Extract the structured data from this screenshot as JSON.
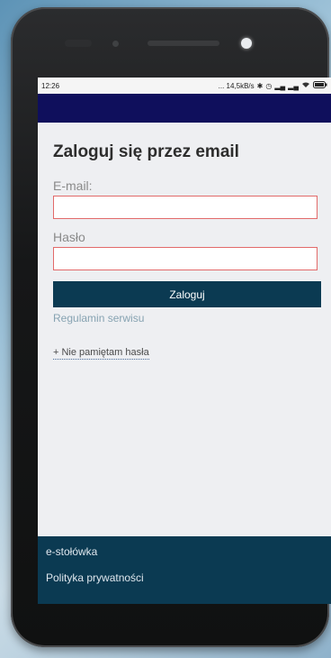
{
  "statusbar": {
    "time": "12:26",
    "speed": "... 14,5kB/s",
    "icons": [
      "bluetooth-icon",
      "alarm-icon",
      "signal-icon",
      "signal-icon",
      "wifi-icon",
      "battery-icon"
    ]
  },
  "page": {
    "title": "Zaloguj się przez email"
  },
  "form": {
    "email_label": "E-mail:",
    "email_value": "",
    "password_label": "Hasło",
    "password_value": "",
    "submit_label": "Zaloguj",
    "terms_link": "Regulamin serwisu",
    "forgot_link": "+ Nie pamiętam hasła"
  },
  "footer": {
    "items": [
      {
        "label": "e-stołówka"
      },
      {
        "label": "Polityka prywatności"
      }
    ]
  },
  "colors": {
    "header": "#0f0f5c",
    "button": "#0b3a52",
    "footer": "#0b3a52",
    "input_border": "#e26a6a"
  }
}
